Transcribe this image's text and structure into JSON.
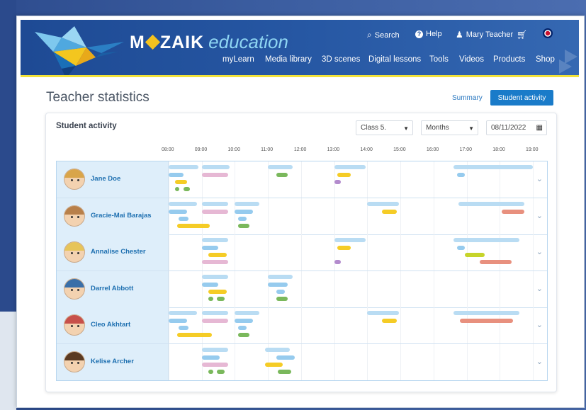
{
  "header": {
    "brand": {
      "word_left": "M",
      "word_right": "ZAIK",
      "subtitle": "education"
    },
    "utilities": [
      {
        "icon": "search-icon",
        "glyph": "🔍",
        "label": "Search"
      },
      {
        "icon": "help-icon",
        "glyph": "?",
        "label": "Help"
      },
      {
        "icon": "user-icon",
        "glyph": "👤",
        "label": "Mary Teacher"
      }
    ],
    "nav": [
      "myLearn",
      "Media library",
      "3D scenes",
      "Digital lessons",
      "Tools",
      "Videos",
      "Products",
      "Shop"
    ]
  },
  "page": {
    "title": "Teacher statistics",
    "tabs": {
      "summary": "Summary",
      "active": "Student activity"
    }
  },
  "card": {
    "title": "Student activity",
    "filters": {
      "class": "Class 5.",
      "period": "Months",
      "date": "08/11/2022"
    },
    "time_labels": [
      "08:00",
      "09:00",
      "10:00",
      "11:00",
      "12:00",
      "13:00",
      "14:00",
      "15:00",
      "16:00",
      "17:00",
      "18:00",
      "19:00"
    ]
  },
  "colors": {
    "lightblue": "#b9dcf3",
    "blue": "#96cbee",
    "pink": "#e6b8d4",
    "yellow": "#f5cc26",
    "green": "#7ab85c",
    "purple": "#b38bcd",
    "salmon": "#e8907e",
    "lime": "#c6d42a"
  },
  "students": [
    {
      "name": "Jane Doe",
      "hair": "#d9a54a",
      "bars": [
        {
          "c": "lightblue",
          "s": 8.0,
          "e": 8.9,
          "l": 0
        },
        {
          "c": "blue",
          "s": 8.0,
          "e": 8.45,
          "l": 1
        },
        {
          "c": "yellow",
          "s": 8.2,
          "e": 8.55,
          "l": 2
        },
        {
          "c": "green",
          "s": 8.2,
          "e": 8.3,
          "l": 3
        },
        {
          "c": "green",
          "s": 8.45,
          "e": 8.65,
          "l": 3
        },
        {
          "c": "lightblue",
          "s": 9.0,
          "e": 9.85,
          "l": 0
        },
        {
          "c": "pink",
          "s": 9.0,
          "e": 9.8,
          "l": 1
        },
        {
          "c": "lightblue",
          "s": 11.0,
          "e": 11.75,
          "l": 0
        },
        {
          "c": "green",
          "s": 11.25,
          "e": 11.6,
          "l": 1
        },
        {
          "c": "lightblue",
          "s": 13.0,
          "e": 13.95,
          "l": 0
        },
        {
          "c": "yellow",
          "s": 13.1,
          "e": 13.5,
          "l": 1
        },
        {
          "c": "purple",
          "s": 13.0,
          "e": 13.2,
          "l": 2
        },
        {
          "c": "lightblue",
          "s": 16.6,
          "e": 19.0,
          "l": 0
        },
        {
          "c": "blue",
          "s": 16.7,
          "e": 16.95,
          "l": 1
        }
      ]
    },
    {
      "name": "Gracie-Mai Barajas",
      "hair": "#b8804a",
      "bars": [
        {
          "c": "lightblue",
          "s": 8.0,
          "e": 8.85,
          "l": 0
        },
        {
          "c": "blue",
          "s": 8.0,
          "e": 8.55,
          "l": 1
        },
        {
          "c": "blue",
          "s": 8.3,
          "e": 8.6,
          "l": 2
        },
        {
          "c": "yellow",
          "s": 8.25,
          "e": 9.25,
          "l": 3
        },
        {
          "c": "lightblue",
          "s": 9.0,
          "e": 9.8,
          "l": 0
        },
        {
          "c": "pink",
          "s": 9.0,
          "e": 9.8,
          "l": 1
        },
        {
          "c": "lightblue",
          "s": 10.0,
          "e": 10.75,
          "l": 0
        },
        {
          "c": "blue",
          "s": 10.0,
          "e": 10.55,
          "l": 1
        },
        {
          "c": "blue",
          "s": 10.1,
          "e": 10.35,
          "l": 2
        },
        {
          "c": "green",
          "s": 10.1,
          "e": 10.45,
          "l": 3
        },
        {
          "c": "lightblue",
          "s": 14.0,
          "e": 14.95,
          "l": 0
        },
        {
          "c": "yellow",
          "s": 14.45,
          "e": 14.9,
          "l": 1
        },
        {
          "c": "lightblue",
          "s": 16.75,
          "e": 18.75,
          "l": 0
        },
        {
          "c": "salmon",
          "s": 18.05,
          "e": 18.75,
          "l": 1
        }
      ]
    },
    {
      "name": "Annalise Chester",
      "hair": "#e6c45a",
      "bars": [
        {
          "c": "lightblue",
          "s": 9.0,
          "e": 9.8,
          "l": 0
        },
        {
          "c": "blue",
          "s": 9.0,
          "e": 9.5,
          "l": 1
        },
        {
          "c": "yellow",
          "s": 9.2,
          "e": 9.75,
          "l": 2
        },
        {
          "c": "pink",
          "s": 9.0,
          "e": 9.8,
          "l": 3
        },
        {
          "c": "lightblue",
          "s": 13.0,
          "e": 13.95,
          "l": 0
        },
        {
          "c": "yellow",
          "s": 13.1,
          "e": 13.5,
          "l": 1
        },
        {
          "c": "purple",
          "s": 13.0,
          "e": 13.2,
          "l": 3
        },
        {
          "c": "lightblue",
          "s": 16.6,
          "e": 18.6,
          "l": 0
        },
        {
          "c": "blue",
          "s": 16.7,
          "e": 16.95,
          "l": 1
        },
        {
          "c": "lime",
          "s": 16.95,
          "e": 17.55,
          "l": 2
        },
        {
          "c": "salmon",
          "s": 17.4,
          "e": 18.35,
          "l": 3
        }
      ]
    },
    {
      "name": "Darrel Abbott",
      "hair": "#3a6fa8",
      "bars": [
        {
          "c": "lightblue",
          "s": 9.0,
          "e": 9.8,
          "l": 0
        },
        {
          "c": "blue",
          "s": 9.0,
          "e": 9.5,
          "l": 1
        },
        {
          "c": "yellow",
          "s": 9.2,
          "e": 9.75,
          "l": 2
        },
        {
          "c": "green",
          "s": 9.2,
          "e": 9.35,
          "l": 3
        },
        {
          "c": "green",
          "s": 9.45,
          "e": 9.7,
          "l": 3
        },
        {
          "c": "lightblue",
          "s": 11.0,
          "e": 11.75,
          "l": 0
        },
        {
          "c": "blue",
          "s": 11.0,
          "e": 11.6,
          "l": 1
        },
        {
          "c": "blue",
          "s": 11.25,
          "e": 11.5,
          "l": 2
        },
        {
          "c": "green",
          "s": 11.25,
          "e": 11.6,
          "l": 3
        }
      ]
    },
    {
      "name": "Cleo Akhtart",
      "hair": "#c7504a",
      "bars": [
        {
          "c": "lightblue",
          "s": 8.0,
          "e": 8.85,
          "l": 0
        },
        {
          "c": "blue",
          "s": 8.0,
          "e": 8.55,
          "l": 1
        },
        {
          "c": "blue",
          "s": 8.3,
          "e": 8.6,
          "l": 2
        },
        {
          "c": "yellow",
          "s": 8.25,
          "e": 9.3,
          "l": 3
        },
        {
          "c": "lightblue",
          "s": 9.0,
          "e": 9.8,
          "l": 0
        },
        {
          "c": "pink",
          "s": 9.0,
          "e": 9.8,
          "l": 1
        },
        {
          "c": "lightblue",
          "s": 10.0,
          "e": 10.75,
          "l": 0
        },
        {
          "c": "blue",
          "s": 10.0,
          "e": 10.55,
          "l": 1
        },
        {
          "c": "blue",
          "s": 10.1,
          "e": 10.35,
          "l": 2
        },
        {
          "c": "green",
          "s": 10.1,
          "e": 10.45,
          "l": 3
        },
        {
          "c": "lightblue",
          "s": 14.0,
          "e": 14.95,
          "l": 0
        },
        {
          "c": "yellow",
          "s": 14.45,
          "e": 14.9,
          "l": 1
        },
        {
          "c": "lightblue",
          "s": 16.6,
          "e": 18.6,
          "l": 0
        },
        {
          "c": "salmon",
          "s": 16.8,
          "e": 18.4,
          "l": 1
        }
      ]
    },
    {
      "name": "Kelise Archer",
      "hair": "#5a3a22",
      "bars": [
        {
          "c": "lightblue",
          "s": 9.0,
          "e": 9.8,
          "l": 0
        },
        {
          "c": "blue",
          "s": 9.0,
          "e": 9.55,
          "l": 1
        },
        {
          "c": "pink",
          "s": 9.0,
          "e": 9.8,
          "l": 2
        },
        {
          "c": "green",
          "s": 9.2,
          "e": 9.35,
          "l": 3
        },
        {
          "c": "green",
          "s": 9.45,
          "e": 9.7,
          "l": 3
        },
        {
          "c": "lightblue",
          "s": 10.9,
          "e": 11.65,
          "l": 0
        },
        {
          "c": "blue",
          "s": 11.25,
          "e": 11.8,
          "l": 1
        },
        {
          "c": "yellow",
          "s": 10.9,
          "e": 11.45,
          "l": 2
        },
        {
          "c": "green",
          "s": 11.3,
          "e": 11.7,
          "l": 3
        }
      ]
    }
  ]
}
